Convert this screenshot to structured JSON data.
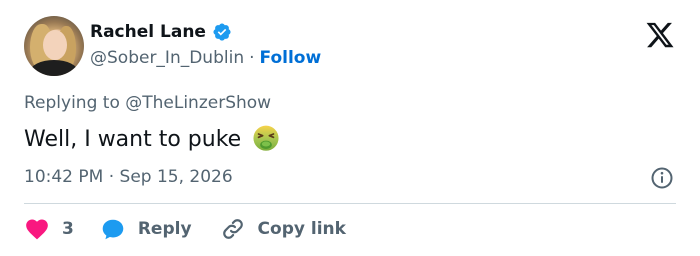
{
  "author": {
    "name": "Rachel Lane",
    "handle": "@Sober_In_Dublin",
    "separator": "·",
    "follow_label": "Follow"
  },
  "reply_context": {
    "prefix": "Replying to",
    "mention": "@TheLinzerShow"
  },
  "tweet": {
    "text": "Well, I want to puke",
    "emoji": "nauseated-face-icon",
    "timestamp": "10:42 PM · Sep 15, 2026"
  },
  "actions": {
    "like_count": "3",
    "reply_label": "Reply",
    "copy_label": "Copy link"
  },
  "colors": {
    "accent": "#006fd6",
    "heart": "#f91880",
    "reply_bubble": "#1d9bf0",
    "muted_text": "#536471",
    "verified": "#1d9bf0"
  }
}
